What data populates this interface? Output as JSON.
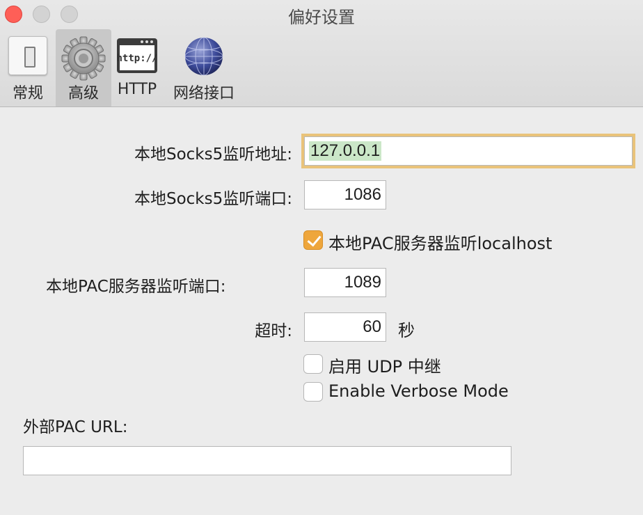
{
  "window": {
    "title": "偏好设置"
  },
  "tabs": [
    {
      "label": "常规",
      "icon": "general-switch-icon"
    },
    {
      "label": "高级",
      "icon": "gear-icon"
    },
    {
      "label": "HTTP",
      "icon": "http-window-icon"
    },
    {
      "label": "网络接口",
      "icon": "network-globe-icon"
    }
  ],
  "selected_tab": "高级",
  "form": {
    "socks5_address_label": "本地Socks5监听地址:",
    "socks5_address_value": "127.0.0.1",
    "socks5_port_label": "本地Socks5监听端口:",
    "socks5_port_value": "1086",
    "pac_localhost_label": "本地PAC服务器监听localhost",
    "pac_localhost_checked": true,
    "pac_port_label": "本地PAC服务器监听端口:",
    "pac_port_value": "1089",
    "timeout_label": "超时:",
    "timeout_value": "60",
    "timeout_unit": "秒",
    "udp_relay_label": "启用 UDP 中继",
    "udp_relay_checked": false,
    "verbose_label": "Enable Verbose Mode",
    "verbose_checked": false,
    "external_pac_label": "外部PAC URL:",
    "external_pac_value": ""
  },
  "colors": {
    "accent": "#eea63c",
    "focus_ring": "#e9c37a",
    "selection": "#cbe7c8",
    "close_button": "#fe5f57"
  }
}
